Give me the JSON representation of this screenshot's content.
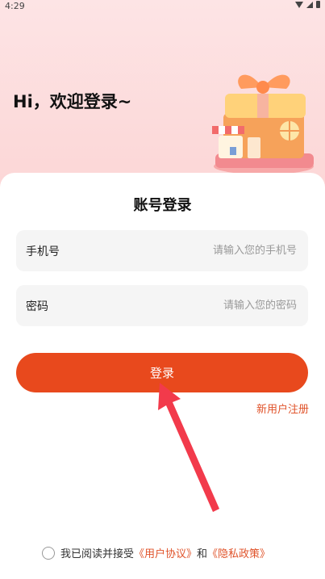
{
  "status_bar": {
    "time": "4:29"
  },
  "hero": {
    "greeting": "Hi，欢迎登录~"
  },
  "login_card": {
    "title": "账号登录",
    "phone": {
      "label": "手机号",
      "placeholder": "请输入您的手机号",
      "value": ""
    },
    "password": {
      "label": "密码",
      "placeholder": "请输入您的密码",
      "value": ""
    },
    "login_label": "登录",
    "register_label": "新用户注册"
  },
  "agreement": {
    "prefix": "我已阅读并接受",
    "user_agreement": "《用户协议》",
    "conjunction": "和",
    "privacy_policy": "《隐私政策》",
    "checked": false
  },
  "colors": {
    "accent": "#e8491d",
    "link": "#e0532a",
    "hero_bg": "#fde4e5",
    "field_bg": "#f5f5f5"
  },
  "icons": [
    "wifi-icon",
    "signal-icon",
    "battery-icon",
    "gift-shop-illustration",
    "arrow-pointer-icon"
  ]
}
